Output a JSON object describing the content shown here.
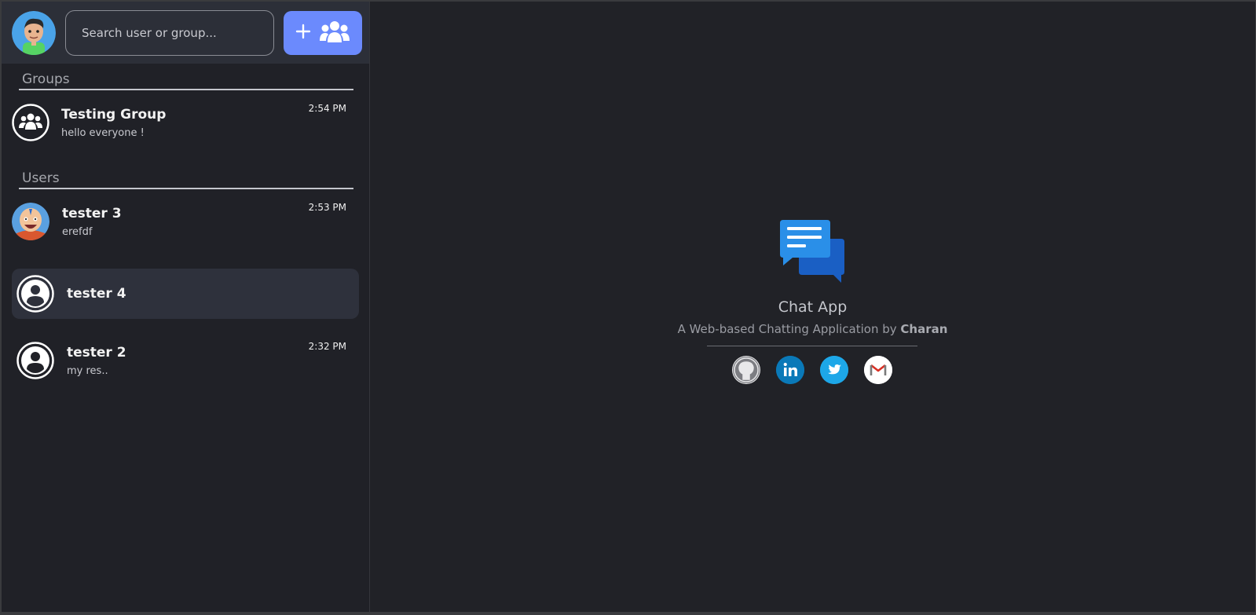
{
  "header": {
    "search_placeholder": "Search user or group..."
  },
  "groups": {
    "title": "Groups",
    "items": [
      {
        "name": "Testing Group",
        "preview": "hello everyone !",
        "time": "2:54 PM"
      }
    ]
  },
  "users": {
    "title": "Users",
    "items": [
      {
        "name": "tester 3",
        "preview": "erefdf",
        "time": "2:53 PM"
      },
      {
        "name": "tester 4",
        "preview": "",
        "time": ""
      },
      {
        "name": "tester 2",
        "preview": "my res..",
        "time": "2:32 PM"
      }
    ]
  },
  "welcome": {
    "app_name": "Chat App",
    "tagline_prefix": "A Web-based Chatting Application by ",
    "author": "Charan"
  },
  "socials": [
    "github-icon",
    "linkedin-icon",
    "twitter-icon",
    "gmail-icon"
  ],
  "colors": {
    "accent": "#6b8afd",
    "background": "#212227",
    "header": "#2c2f38",
    "active_item": "#2e313c"
  }
}
